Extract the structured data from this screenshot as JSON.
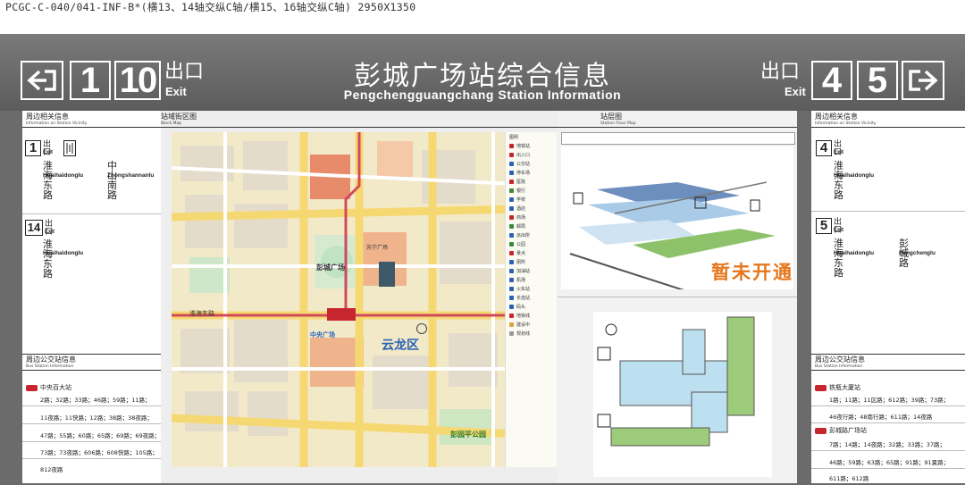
{
  "spec_line": "PCGC-C-040/041-INF-B*(横13、14轴交纵C轴/横15、16轴交纵C轴)  2950X1350",
  "header": {
    "title_cn": "彭城广场站综合信息",
    "title_en": "Pengchengguangchang Station Information",
    "left_exits": [
      "1",
      "10"
    ],
    "right_exits": [
      "4",
      "5"
    ],
    "exit_cn": "出口",
    "exit_en": "Exit"
  },
  "left_panel": {
    "vicinity_title_cn": "周边相关信息",
    "vicinity_title_en": "Information on Station Vicinity",
    "exits": [
      {
        "num": "1",
        "exit_cn": "出口",
        "exit_en": "Exit",
        "roads": [
          {
            "cn": "淮海东路",
            "en": "Huaihaidonglu"
          },
          {
            "cn": "中山南路",
            "en": "Zhongshannanlu"
          }
        ]
      },
      {
        "num": "14",
        "exit_cn": "出口",
        "exit_en": "Exit",
        "roads": [
          {
            "cn": "淮海东路",
            "en": "Huaihaidonglu"
          }
        ]
      }
    ],
    "bus_title_cn": "周边公交站信息",
    "bus_title_en": "Bus Station Information",
    "bus_stop": "中央百大站",
    "bus_lines": [
      "2路；32路；33路；46路；59路；11路；",
      "11夜路；11快路；12路；38路；38夜路；",
      "47路；55路；60路；65路；69路；69夜路；",
      "73路；73夜路；606路；608快路；105路；",
      "812夜路"
    ]
  },
  "map_panel": {
    "title_cn": "站域街区图",
    "title_en": "Block Map",
    "district_1": "彭城广场",
    "district_2": "云龙区",
    "district_3": "中央广场",
    "district_4": "苏宁广场",
    "district_5": "彭园平公园",
    "road_label": "淮海东路",
    "legend": [
      "图例",
      "地铁站",
      "出入口",
      "公交站",
      "停车场",
      "医院",
      "银行",
      "学校",
      "酒店",
      "商场",
      "邮局",
      "派出所",
      "公园",
      "景点",
      "厕所",
      "加油站",
      "机场",
      "火车站",
      "长途站",
      "码头",
      "地铁线",
      "建设中",
      "规划线"
    ]
  },
  "floor_panel": {
    "title_cn": "站层图",
    "title_en": "Station Floor Map",
    "notice": "暂未开通"
  },
  "right_panel": {
    "vicinity_title_cn": "周边相关信息",
    "vicinity_title_en": "Information on Station Vicinity",
    "exits": [
      {
        "num": "4",
        "exit_cn": "出口",
        "exit_en": "Exit",
        "roads": [
          {
            "cn": "淮海东路",
            "en": "Huaihaidonglu"
          }
        ]
      },
      {
        "num": "5",
        "exit_cn": "出口",
        "exit_en": "Exit",
        "roads": [
          {
            "cn": "淮海东路",
            "en": "Huaihaidonglu"
          },
          {
            "cn": "彭城路",
            "en": "Pengchenglu"
          }
        ]
      }
    ],
    "bus_title_cn": "周边公交站信息",
    "bus_title_en": "Bus Station Information",
    "bus_stops": [
      {
        "name": "铁瓶大厦站",
        "lines": [
          "1路；11路；11区路；612路；39路；73路；",
          "46夜行路；48南行路；611路；14夜路"
        ]
      },
      {
        "name": "彭城路广场站",
        "lines": [
          "7路；14路；14夜路；32路；33路；37路；",
          "46路；59路；63路；65路；91路；91夏路；",
          "611路；612路"
        ]
      }
    ]
  }
}
